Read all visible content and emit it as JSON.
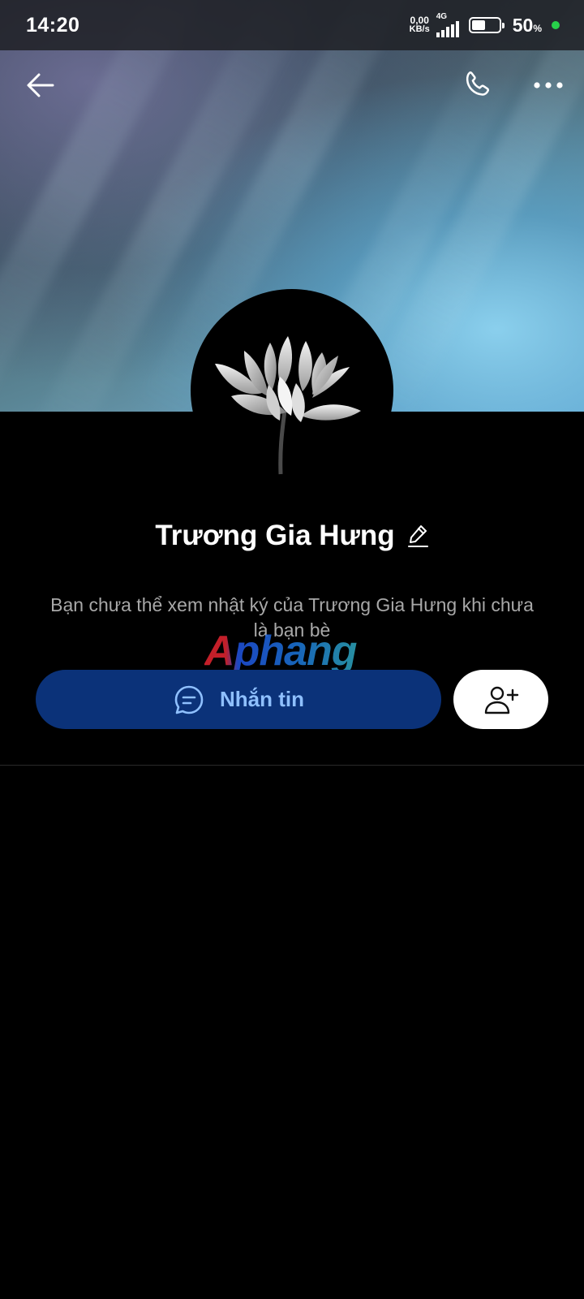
{
  "status_bar": {
    "time": "14:20",
    "net_speed_value": "0,00",
    "net_speed_unit": "KB/s",
    "network_type": "4G",
    "battery_percent": "50",
    "battery_percent_sign": "%",
    "battery_level": 0.5
  },
  "header": {
    "back_icon": "arrow-left-icon",
    "call_icon": "phone-icon",
    "more_icon": "more-dots-icon"
  },
  "profile": {
    "name": "Trương Gia Hưng",
    "edit_icon": "pencil-icon",
    "notice": "Bạn chưa thể xem nhật ký của Trương Gia Hưng khi chưa là bạn bè"
  },
  "actions": {
    "message_label": "Nhắn tin",
    "message_icon": "chat-bubble-icon",
    "add_friend_icon": "add-user-icon"
  },
  "watermark": {
    "text": "Aphang"
  },
  "colors": {
    "message_button_bg": "#0b3279",
    "message_button_text": "#8fc0ff",
    "background": "#000000",
    "status_dot": "#27d04a"
  }
}
